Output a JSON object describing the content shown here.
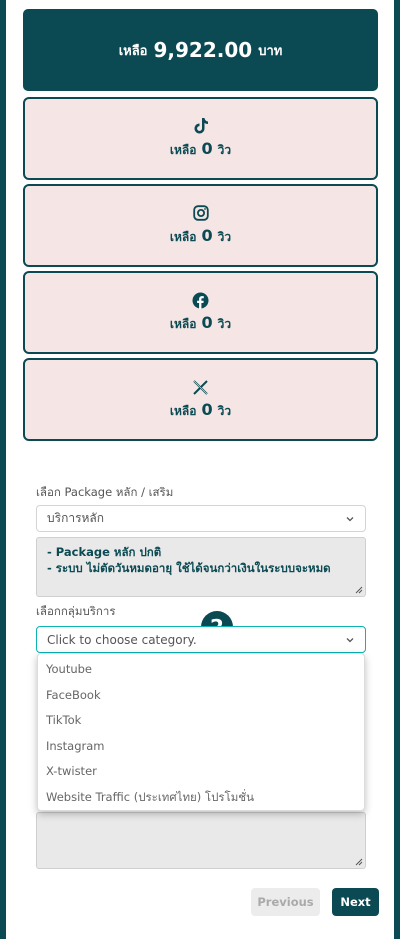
{
  "balance": {
    "label": "เหลือ",
    "amount": "9,922.00",
    "unit": "บาท"
  },
  "platforms": [
    {
      "icon": "tiktok-icon",
      "label": "เหลือ",
      "count": "0",
      "unit": "วิว"
    },
    {
      "icon": "instagram-icon",
      "label": "เหลือ",
      "count": "0",
      "unit": "วิว"
    },
    {
      "icon": "facebook-icon",
      "label": "เหลือ",
      "count": "0",
      "unit": "วิว"
    },
    {
      "icon": "x-icon",
      "label": "เหลือ",
      "count": "0",
      "unit": "วิว"
    }
  ],
  "package_section": {
    "label": "เลือก Package หลัก / เสริม",
    "selected": "บริการหลัก",
    "notes": [
      "- Package หลัก ปกติ",
      "- ระบบ ไม่ตัดวันหมดอายุ ใช้ได้จนกว่าเงินในระบบจะหมด"
    ]
  },
  "category_section": {
    "label": "เลือกกลุ่มบริการ",
    "placeholder": "Click to choose category.",
    "step_badge": "2",
    "options": [
      "Youtube",
      "FaceBook",
      "TikTok",
      "Instagram",
      "X-twister",
      "Website Traffic (ประเทศไทย) โปรโมชั่น"
    ]
  },
  "nav": {
    "previous": "Previous",
    "next": "Next"
  },
  "colors": {
    "brand": "#0b4a53",
    "card_bg": "#f5e6e5",
    "accent": "#0bb3b3"
  }
}
